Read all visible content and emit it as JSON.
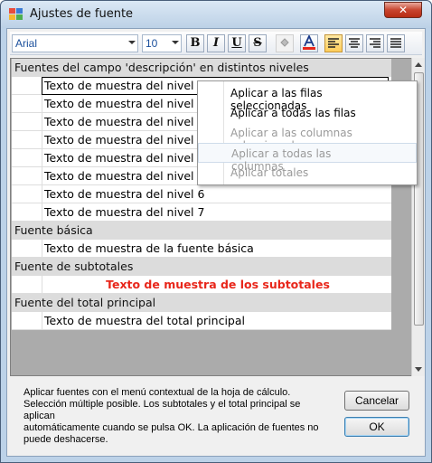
{
  "window": {
    "title": "Ajustes de fuente",
    "close_label": "✕"
  },
  "toolbar": {
    "font_name": "Arial",
    "font_size": "10",
    "bold": "B",
    "italic": "I",
    "underline": "U",
    "strike": "S"
  },
  "grid": {
    "rows": [
      {
        "kind": "header",
        "text": "Fuentes del campo 'descripción' en distintos niveles"
      },
      {
        "kind": "item",
        "text": "Texto de muestra del nivel 0"
      },
      {
        "kind": "item",
        "text": "Texto de muestra del nivel 1"
      },
      {
        "kind": "item",
        "text": "Texto de muestra del nivel 2"
      },
      {
        "kind": "item",
        "text": "Texto de muestra del nivel 3"
      },
      {
        "kind": "item",
        "text": "Texto de muestra del nivel 4"
      },
      {
        "kind": "item",
        "text": "Texto de muestra del nivel 5"
      },
      {
        "kind": "item",
        "text": "Texto de muestra del nivel 6"
      },
      {
        "kind": "item",
        "text": "Texto de muestra del nivel 7"
      },
      {
        "kind": "header",
        "text": "Fuente básica"
      },
      {
        "kind": "item",
        "text": "Texto de muestra de la fuente básica"
      },
      {
        "kind": "header",
        "text": "Fuente de subtotales"
      },
      {
        "kind": "subtotal",
        "text": "Texto de muestra de los subtotales"
      },
      {
        "kind": "header",
        "text": "Fuente del total principal"
      },
      {
        "kind": "item",
        "text": "Texto de muestra del total principal"
      }
    ]
  },
  "context_menu": {
    "items": [
      {
        "label": "Aplicar a las filas seleccionadas",
        "enabled": true
      },
      {
        "label": "Aplicar a todas las filas",
        "enabled": true
      },
      {
        "label": "Aplicar a las columnas seleccionadas",
        "enabled": false
      },
      {
        "label": "Aplicar a todas las columnas",
        "enabled": false
      },
      {
        "label": "Aplicar totales",
        "enabled": false
      }
    ]
  },
  "info": {
    "line1": "Aplicar fuentes con el menú contextual de la hoja de cálculo.",
    "line2": "Selección múltiple posible. Los subtotales y el total principal se aplican",
    "line3": "automáticamente cuando se pulsa OK. La aplicación de fuentes no",
    "line4": "puede deshacerse."
  },
  "buttons": {
    "cancel": "Cancelar",
    "ok": "OK"
  },
  "colors": {
    "subtotal_text": "#e8261a",
    "font_color_bar": "#e8261a"
  }
}
